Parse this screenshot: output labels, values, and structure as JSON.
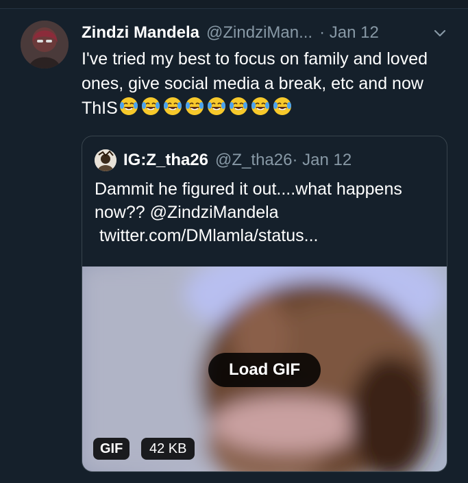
{
  "tweet": {
    "name": "Zindzi Mandela",
    "handle": "@ZindziMan...",
    "date": "· Jan 12",
    "text": "I've tried my best to focus on family and loved ones, give social media a break, etc and now ThIS",
    "emoji_count": 8,
    "emoji_name": "face-with-tears-of-joy-icon"
  },
  "quoted": {
    "name": "IG:Z_tha26",
    "handle": "@Z_tha26",
    "date": "· Jan 12",
    "text_line1": "Dammit he figured it out....what happens",
    "text_line2": "now?? @ZindziMandela",
    "text_line3": " twitter.com/DMlamla/status...",
    "media": {
      "load_label": "Load GIF",
      "type_badge": "GIF",
      "size_badge": "42 KB"
    }
  },
  "colors": {
    "background": "#15202b",
    "secondary_text": "#8899a6",
    "border": "#38444d"
  }
}
